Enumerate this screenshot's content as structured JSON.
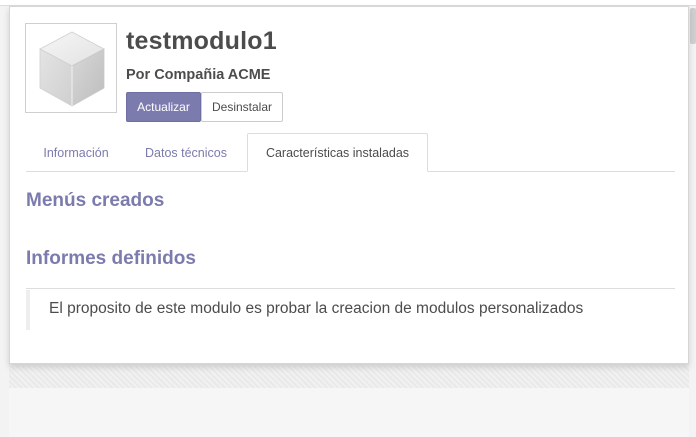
{
  "module": {
    "name": "testmodulo1",
    "author": "Por Compañia ACME",
    "image_icon": "module-cube-icon",
    "description": "El proposito de este modulo es probar la creacion de modulos personalizados"
  },
  "buttons": {
    "update": "Actualizar",
    "uninstall": "Desinstalar"
  },
  "tabs": [
    {
      "label": "Información",
      "active": false
    },
    {
      "label": "Datos técnicos",
      "active": false
    },
    {
      "label": "Características instaladas",
      "active": true
    }
  ],
  "sections": {
    "menus": "Menús creados",
    "reports": "Informes definidos"
  },
  "colors": {
    "accent": "#7c7bad",
    "text": "#4c4c4c",
    "border": "#dddddd"
  }
}
